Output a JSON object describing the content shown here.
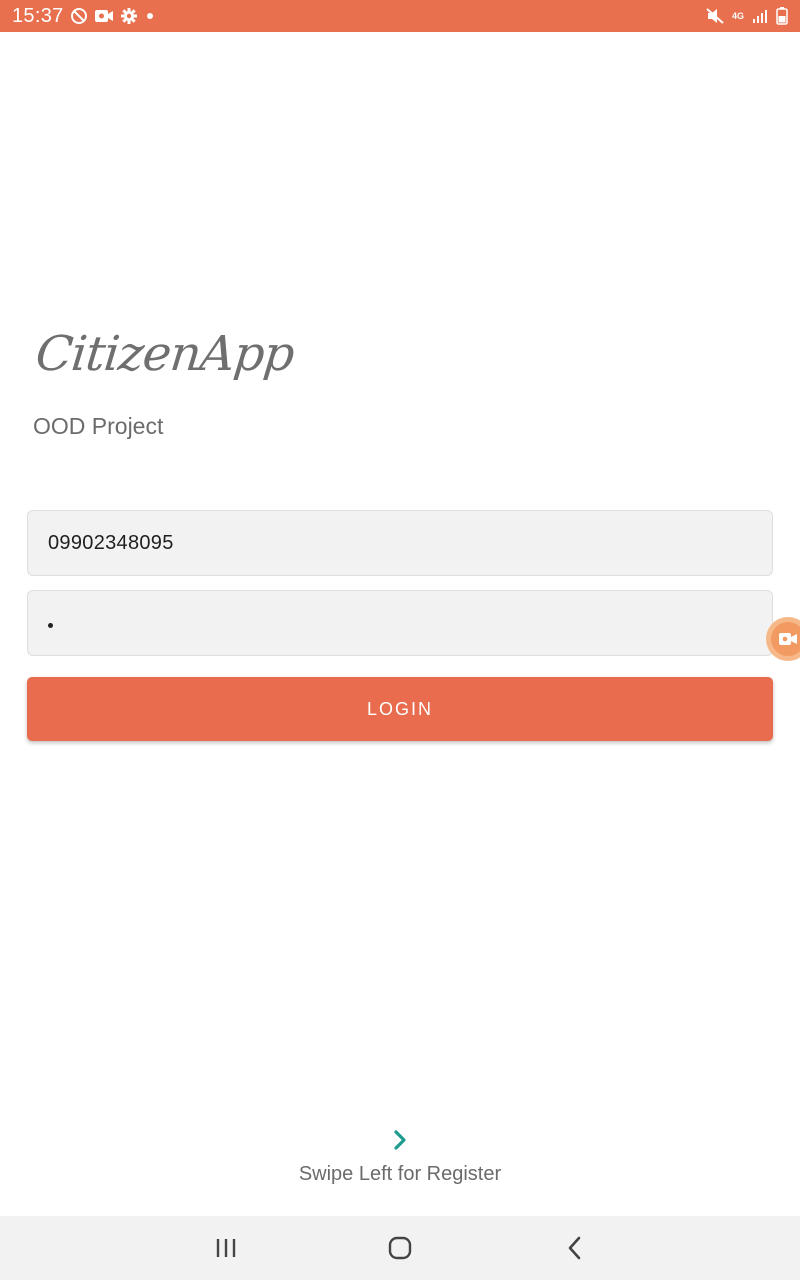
{
  "status_bar": {
    "time": "15:37",
    "network_label": "4G",
    "background_color": "#e8704f",
    "icons_left": [
      "do-not-disturb-icon",
      "screen-record-icon",
      "settings-gear-icon",
      "notification-dot-icon"
    ],
    "icons_right": [
      "mute-icon",
      "network-4g-icon",
      "signal-icon",
      "battery-icon"
    ]
  },
  "app": {
    "logo_text": "CitizenApp",
    "subtitle": "OOD Project"
  },
  "login_form": {
    "phone_value": "09902348095",
    "password_masked": "•",
    "login_label": "LOGIN",
    "accent_color": "#e86c4d"
  },
  "swipe": {
    "hint": "Swipe Left for Register",
    "chevron_color": "#1e9a8f"
  },
  "nav_bar": {
    "buttons": [
      "recents-icon",
      "home-icon",
      "back-icon"
    ]
  }
}
